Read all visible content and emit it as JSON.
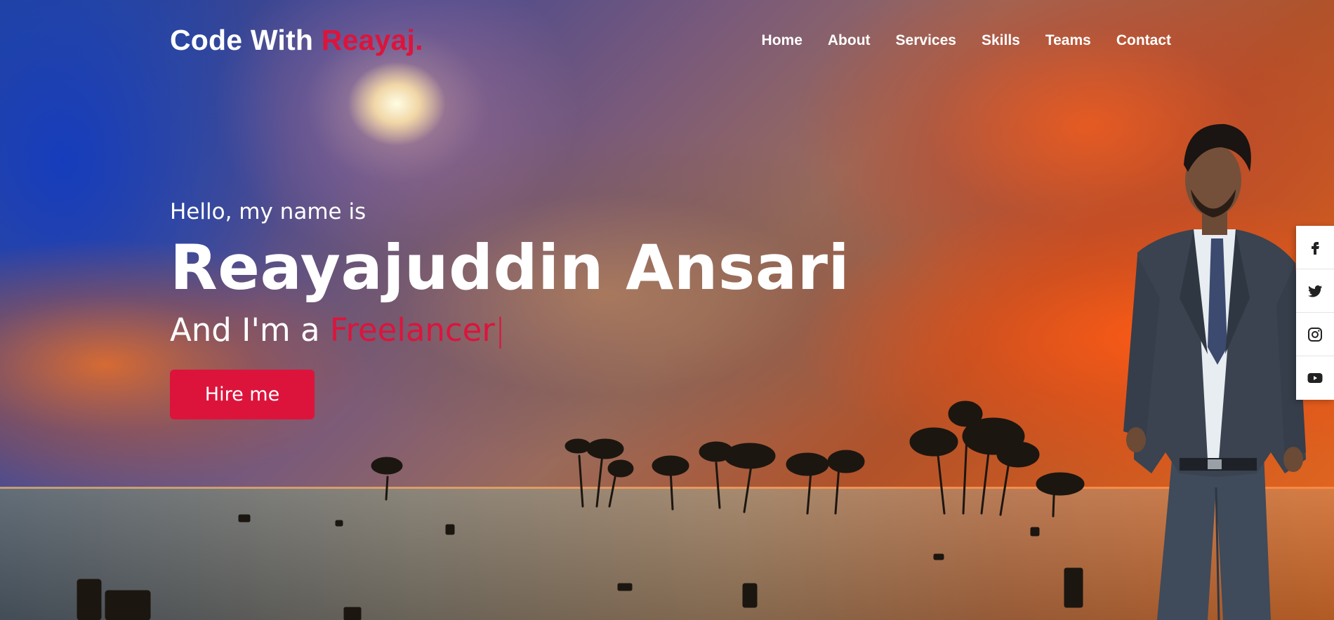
{
  "brand": {
    "prefix": "Code With",
    "accent": "Reayaj."
  },
  "nav": {
    "items": [
      {
        "label": "Home"
      },
      {
        "label": "About"
      },
      {
        "label": "Services"
      },
      {
        "label": "Skills"
      },
      {
        "label": "Teams"
      },
      {
        "label": "Contact"
      }
    ]
  },
  "hero": {
    "greeting": "Hello, my name is",
    "name": "Reayajuddin Ansari",
    "role_prefix": "And I'm a",
    "role_typed": "Freelancer",
    "cursor": "|",
    "cta_label": "Hire me"
  },
  "social": {
    "icons": [
      "facebook-icon",
      "twitter-icon",
      "instagram-icon",
      "youtube-icon"
    ]
  },
  "colors": {
    "accent": "#dc143c",
    "text": "#ffffff"
  }
}
